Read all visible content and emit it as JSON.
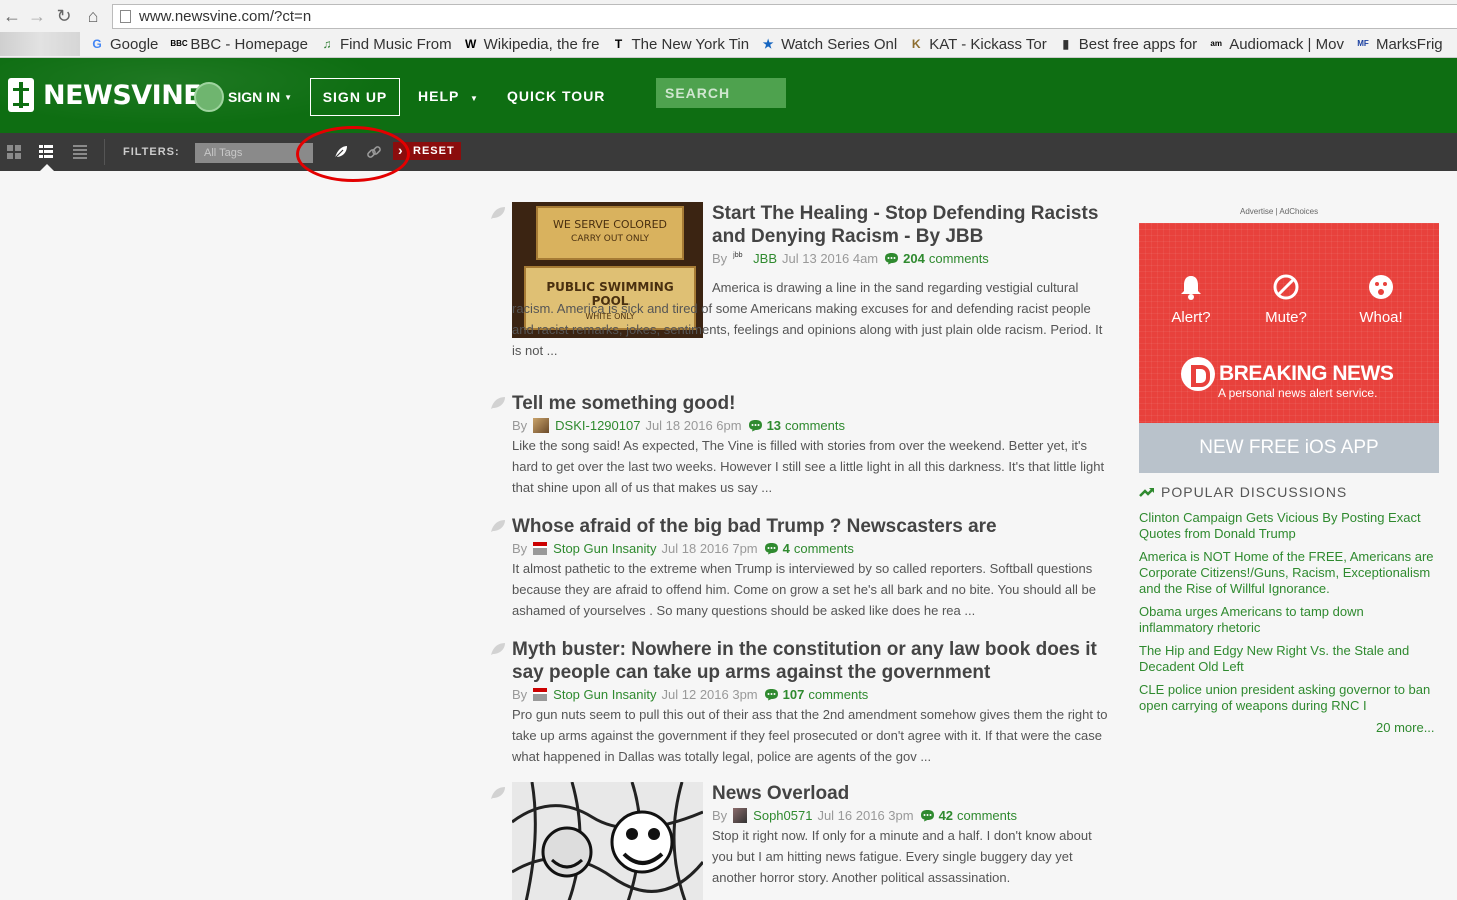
{
  "browser": {
    "url": "www.newsvine.com/?ct=n",
    "bookmarks": [
      {
        "label": "Google",
        "icon": "google-icon",
        "color": "#4285f4",
        "glyph": "G"
      },
      {
        "label": "BBC - Homepage",
        "icon": "bbc-icon",
        "color": "#000000",
        "glyph": "BBC"
      },
      {
        "label": "Find Music From",
        "icon": "music-icon",
        "color": "#2e7d32",
        "glyph": "♫"
      },
      {
        "label": "Wikipedia, the fre",
        "icon": "wikipedia-icon",
        "color": "#000000",
        "glyph": "W"
      },
      {
        "label": "The New York Tin",
        "icon": "nytimes-icon",
        "color": "#000000",
        "glyph": "T"
      },
      {
        "label": "Watch Series Onl",
        "icon": "watch-series-icon",
        "color": "#1565c0",
        "glyph": "★"
      },
      {
        "label": "KAT - Kickass Tor",
        "icon": "kat-icon",
        "color": "#8d6e2f",
        "glyph": "K"
      },
      {
        "label": "Best free apps for",
        "icon": "phone-icon",
        "color": "#333333",
        "glyph": "▮"
      },
      {
        "label": "Audiomack | Mov",
        "icon": "audiomack-icon",
        "color": "#000000",
        "glyph": "am"
      },
      {
        "label": "MarksFrig",
        "icon": "marksfrig-icon",
        "color": "#1a3fa0",
        "glyph": "MF"
      }
    ]
  },
  "header": {
    "logo_text": "NEWSVINE",
    "signin_label": "SIGN IN",
    "signup_label": "SIGN UP",
    "help_label": "HELP",
    "tour_label": "QUICK TOUR",
    "search_placeholder": "SEARCH",
    "brand_color": "#0e6e12"
  },
  "filterbar": {
    "filters_label": "FILTERS:",
    "tags_placeholder": "All Tags",
    "reset_label": "RESET"
  },
  "articles": [
    {
      "title": "Start The Healing - Stop Defending Racists and Denying Racism - By JBB",
      "by": "By",
      "author": "JBB",
      "date": "Jul 13 2016 4am",
      "comments": "204",
      "comments_word": "comments",
      "excerpt": "America is drawing a line in the sand regarding vestigial cultural racism. America is sick and tired of some Americans making excuses for and defending racist people and racist remarks, jokes, sentiments, feelings and opinions along with just plain olde racism. Period. It is not ...",
      "thumb_sign_top_1": "WE SERVE COLORED",
      "thumb_sign_top_2": "CARRY OUT ONLY",
      "thumb_sign_bottom_1": "PUBLIC SWIMMING POOL",
      "thumb_sign_bottom_2": "WHITE ONLY"
    },
    {
      "title": "Tell me something good!",
      "by": "By",
      "author": "DSKI-1290107",
      "date": "Jul 18 2016 6pm",
      "comments": "13",
      "comments_word": "comments",
      "excerpt": "Like the song said! As expected, The Vine is filled with stories from over the weekend. Better yet, it's hard to get over the last two weeks. However I still see a little light in all this darkness. It's that little light that shine upon all of us that makes us say ..."
    },
    {
      "title": "Whose afraid of the big bad Trump ? Newscasters are",
      "by": "By",
      "author": "Stop Gun Insanity",
      "date": "Jul 18 2016 7pm",
      "comments": "4",
      "comments_word": "comments",
      "excerpt": "It almost pathetic to the extreme when Trump is interviewed by so called reporters. Softball questions because they are afraid to offend him. Come on grow a set he's all bark and no bite. You should all be ashamed of yourselves . So many questions should be asked like does he rea ..."
    },
    {
      "title": "Myth buster: Nowhere in the constitution or any law book does it say people can take up arms against the government",
      "by": "By",
      "author": "Stop Gun Insanity",
      "date": "Jul 12 2016 3pm",
      "comments": "107",
      "comments_word": "comments",
      "excerpt": "Pro gun nuts seem to pull this out of their ass that the 2nd amendment somehow gives them the right to take up arms against the government if they feel prosecuted or don't agree with it. If that were the case what happened in Dallas was totally legal, police are agents of the gov ..."
    },
    {
      "title": "News Overload",
      "by": "By",
      "author": "Soph0571",
      "date": "Jul 16 2016 3pm",
      "comments": "42",
      "comments_word": "comments",
      "excerpt": "Stop it right now.  If only for a minute and a half.  I don't know about you but I am hitting news fatigue.  Every single buggery day yet another horror story. Another political assassination."
    }
  ],
  "sidebar": {
    "advertise": "Advertise | AdChoices",
    "ad": {
      "alert": "Alert?",
      "mute": "Mute?",
      "whoa": "Whoa!",
      "brand": "BREAKING NEWS",
      "tagline": "A personal news alert service.",
      "cta": "NEW FREE iOS APP",
      "color": "#e8413c"
    },
    "popular_title": "POPULAR DISCUSSIONS",
    "popular": [
      "Clinton Campaign Gets Vicious By Posting Exact Quotes from Donald Trump",
      "America is NOT Home of the FREE, Americans are Corporate Citizens!/Guns, Racism, Exceptionalism and the Rise of Willful Ignorance.",
      "Obama urges Americans to tamp down inflammatory rhetoric",
      "The Hip and Edgy New Right Vs. the Stale and Decadent Old Left",
      "CLE police union president asking governor to ban open carrying of weapons during RNC I"
    ],
    "more_label": "20 more..."
  }
}
